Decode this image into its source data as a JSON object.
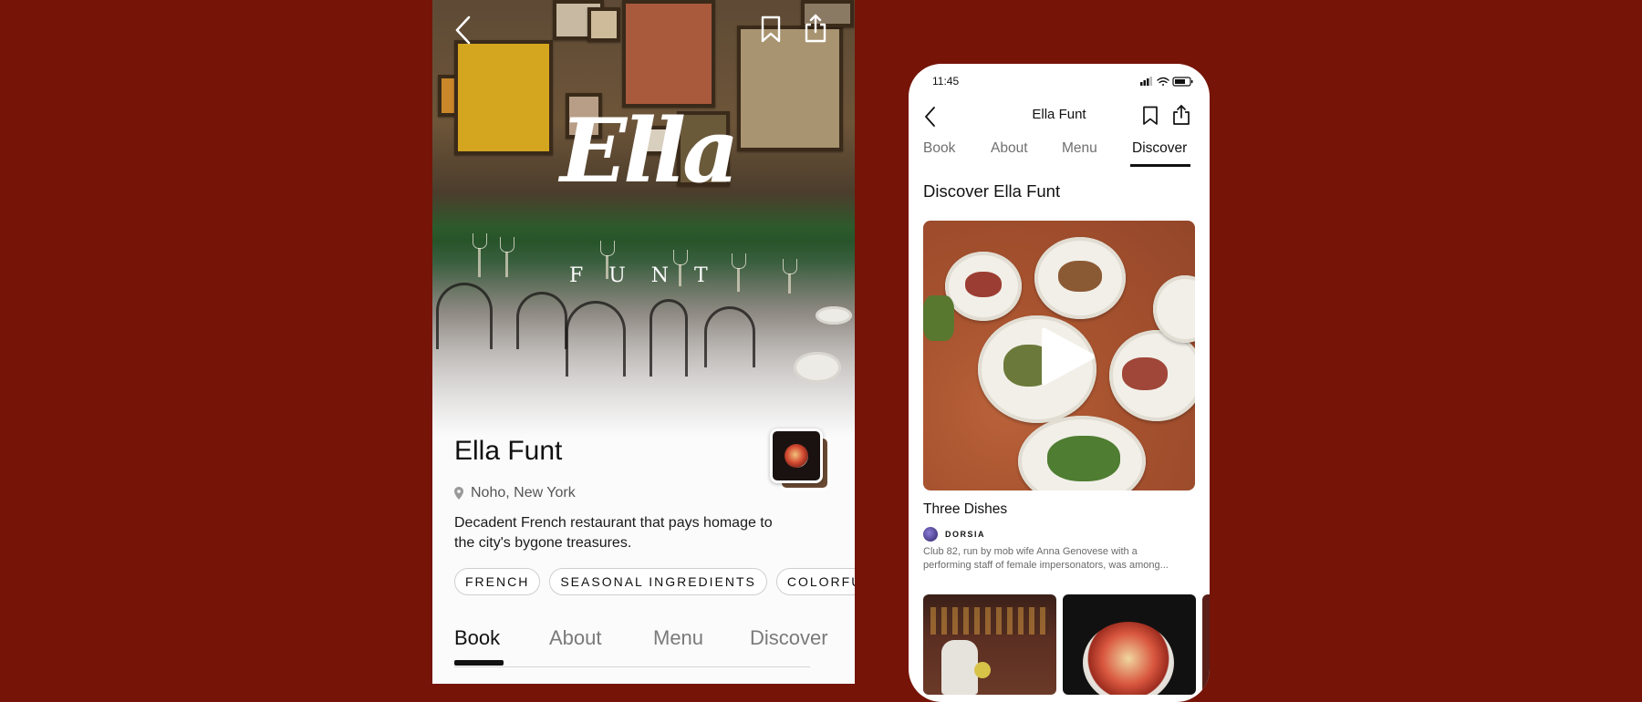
{
  "left_screen": {
    "logo_script": "Ella",
    "logo_sub": "FUNT",
    "title": "Ella Funt",
    "location": "Noho, New York",
    "description": "Decadent French restaurant that pays homage to the city's bygone treasures.",
    "tags": [
      "FRENCH",
      "SEASONAL INGREDIENTS",
      "COLORFUL I"
    ],
    "tabs": [
      "Book",
      "About",
      "Menu",
      "Discover"
    ],
    "active_tab": "Book",
    "icons": [
      "chevron-left-icon",
      "bookmark-icon",
      "share-icon",
      "location-pin-icon"
    ]
  },
  "right_screen": {
    "status_time": "11:45",
    "title": "Ella Funt",
    "tabs": [
      "Book",
      "About",
      "Menu",
      "Discover"
    ],
    "active_tab": "Discover",
    "section_heading": "Discover Ella Funt",
    "video_title": "Three Dishes",
    "source_name": "DORSIA",
    "blurb": "Club 82, run by mob wife Anna Genovese with a performing staff of female impersonators, was among...",
    "icons": [
      "chevron-left-icon",
      "bookmark-icon",
      "share-icon",
      "play-icon",
      "signal-icon",
      "wifi-icon",
      "battery-icon"
    ]
  },
  "colors": {
    "background": "#761408",
    "text_primary": "#111111",
    "text_secondary": "#6f6f6f",
    "banquette_green": "#1f4a25"
  }
}
